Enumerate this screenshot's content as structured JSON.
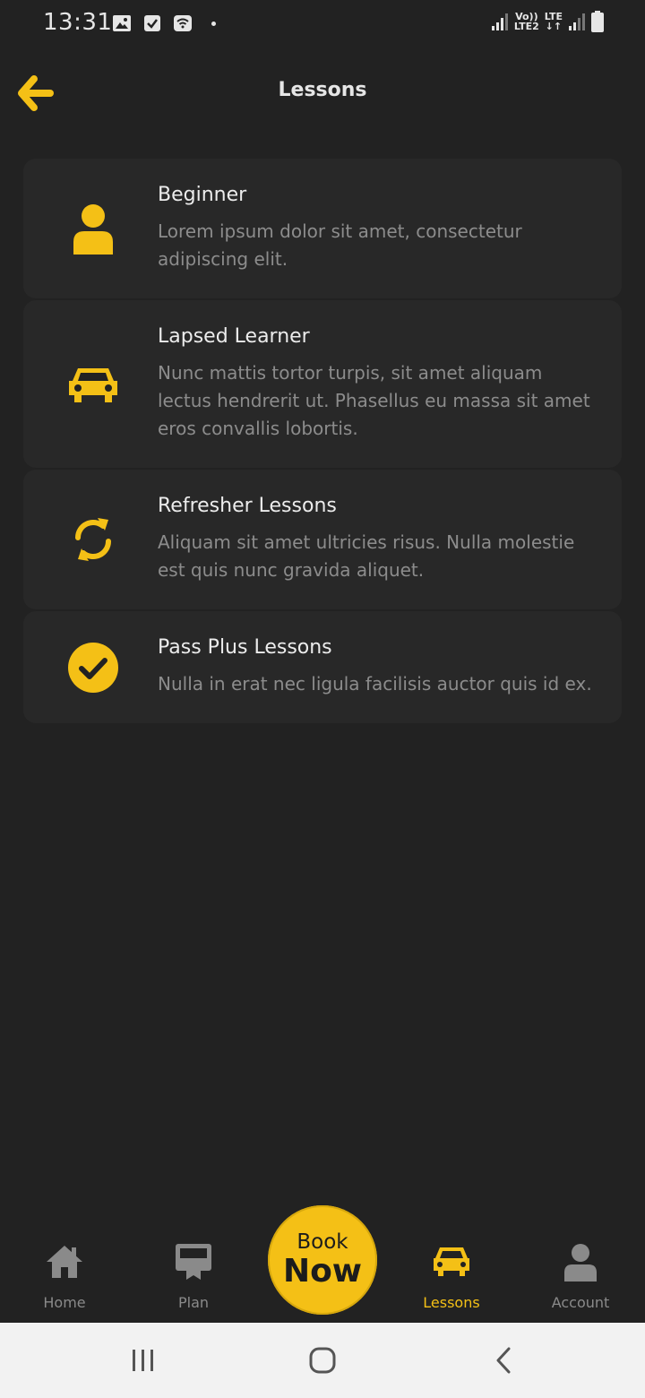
{
  "status_bar": {
    "time": "13:31",
    "net_top": "Vo))",
    "net_bottom": "LTE2",
    "lte": "LTE"
  },
  "header": {
    "title": "Lessons",
    "back_icon": "arrow-left-icon"
  },
  "lessons": [
    {
      "icon": "person-icon",
      "title": "Beginner",
      "description": "Lorem ipsum dolor sit amet, consectetur adipiscing elit."
    },
    {
      "icon": "car-icon",
      "title": "Lapsed Learner",
      "description": "Nunc mattis tortor turpis, sit amet aliquam lectus hendrerit ut. Phasellus eu massa sit amet eros convallis lobortis."
    },
    {
      "icon": "sync-icon",
      "title": "Refresher Lessons",
      "description": "Aliquam sit amet ultricies risus. Nulla molestie est quis nunc gravida aliquet."
    },
    {
      "icon": "check-circle-icon",
      "title": "Pass Plus Lessons",
      "description": "Nulla in erat nec ligula facilisis auctor quis id ex."
    }
  ],
  "bottom_nav": {
    "items": [
      {
        "label": "Home",
        "icon": "home-icon"
      },
      {
        "label": "Plan",
        "icon": "plan-icon"
      },
      {
        "label": "Lessons",
        "icon": "car-icon",
        "active": true
      },
      {
        "label": "Account",
        "icon": "account-icon"
      }
    ],
    "book_now": {
      "line1": "Book",
      "line2": "Now"
    }
  },
  "colors": {
    "accent": "#f4c016",
    "background": "#222222",
    "card": "#282828",
    "muted_text": "#8c8c8c"
  }
}
